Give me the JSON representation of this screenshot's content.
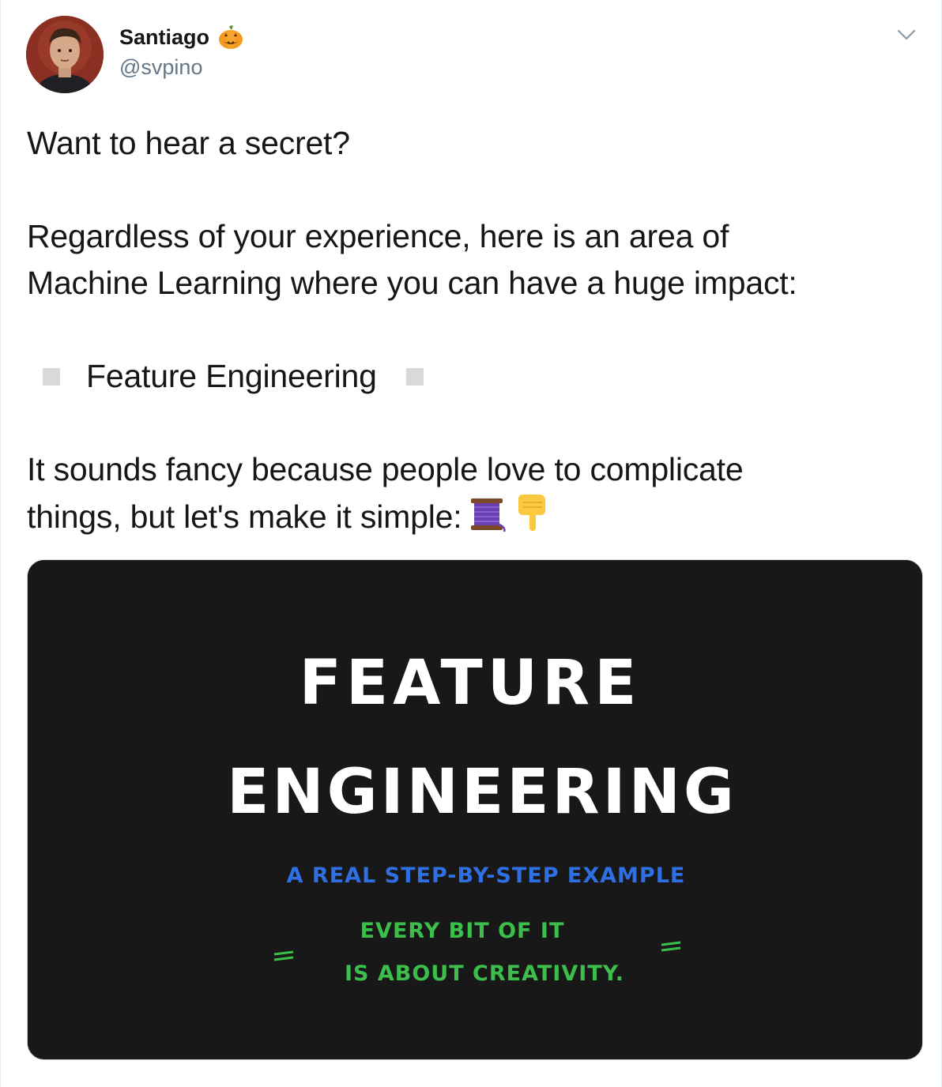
{
  "author": {
    "display_name": "Santiago",
    "handle": "@svpino",
    "name_emoji": "pumpkin-icon"
  },
  "menu": {
    "icon": "chevron-down-icon"
  },
  "tweet": {
    "para1": "Want to hear a secret?",
    "para2_line1": "Regardless of your experience, here is an area of",
    "para2_line2": "Machine Learning where you can have a huge impact:",
    "feature": "Feature Engineering",
    "para4_line1": "It sounds fancy because people love to complicate",
    "para4_line2": "things, but let's make it simple:",
    "emojis": [
      "thread-icon",
      "pointing-down-icon"
    ]
  },
  "media": {
    "title_line1": "FEATURE",
    "title_line2": "ENGINEERING",
    "subtitle": "A REAL STEP-BY-STEP EXAMPLE",
    "note_line1": "EVERY BIT OF IT",
    "note_line2": "IS ABOUT CREATIVITY.",
    "colors": {
      "background": "#181818",
      "title": "#ffffff",
      "subtitle": "#2f6fe4",
      "note": "#3cbf4a"
    }
  }
}
